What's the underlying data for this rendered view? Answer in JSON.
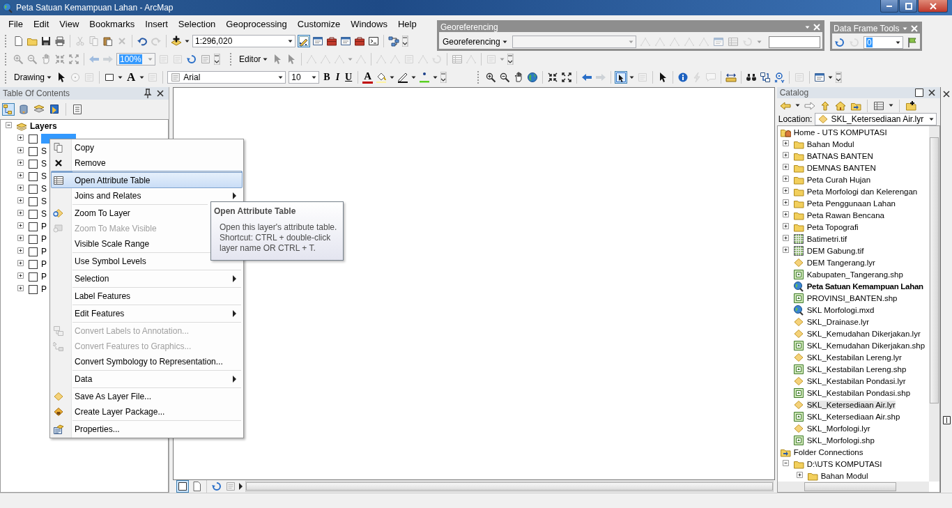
{
  "window": {
    "title": "Peta Satuan Kemampuan Lahan - ArcMap"
  },
  "menu": [
    "File",
    "Edit",
    "View",
    "Bookmarks",
    "Insert",
    "Selection",
    "Geoprocessing",
    "Customize",
    "Windows",
    "Help"
  ],
  "standard_toolbar": {
    "scale": "1:296,020",
    "editor_toolbar_on": true
  },
  "tools_toolbar": {
    "zoom_percent": "100%",
    "editor": "Editor"
  },
  "draw_toolbar": {
    "drawing": "Drawing",
    "text_tool": "A",
    "font": "Arial",
    "font_size": "10",
    "bold": "B",
    "italic": "I",
    "underline": "U",
    "font_color": "A",
    "select_elements_on": true
  },
  "georeferencing": {
    "title": "Georeferencing",
    "menu": "Georeferencing"
  },
  "data_frame_tools": {
    "title": "Data Frame Tools",
    "value": "0"
  },
  "toc": {
    "title": "Table Of Contents",
    "root": "Layers",
    "root_expanded": true,
    "list_by_drawing_order_on": true,
    "layers": [
      {
        "checked": false,
        "expanded": false,
        "selected": true
      },
      {
        "label": "S",
        "checked": false,
        "expanded": false,
        "selected": false
      },
      {
        "label": "S",
        "checked": false,
        "expanded": false,
        "selected": false
      },
      {
        "label": "S",
        "checked": false,
        "expanded": false,
        "selected": false
      },
      {
        "label": "S",
        "checked": false,
        "expanded": false,
        "selected": false
      },
      {
        "label": "S",
        "checked": false,
        "expanded": false,
        "selected": false
      },
      {
        "label": "S",
        "checked": false,
        "expanded": false,
        "selected": false
      },
      {
        "label": "P",
        "checked": false,
        "expanded": false,
        "selected": false
      },
      {
        "label": "P",
        "checked": false,
        "expanded": false,
        "selected": false
      },
      {
        "label": "P",
        "checked": false,
        "expanded": false,
        "selected": false
      },
      {
        "label": "P",
        "checked": false,
        "expanded": false,
        "selected": false
      },
      {
        "label": "P",
        "checked": false,
        "expanded": false,
        "selected": false
      },
      {
        "label": "P",
        "checked": false,
        "expanded": false,
        "selected": false
      }
    ]
  },
  "context_menu": [
    {
      "label": "Copy",
      "disabled": false,
      "submenu": false,
      "selected": false,
      "divider_above": false
    },
    {
      "label": "Remove",
      "disabled": false,
      "submenu": false,
      "selected": false,
      "divider_above": false
    },
    {
      "label": "Open Attribute Table",
      "disabled": false,
      "submenu": false,
      "selected": true,
      "divider_above": true
    },
    {
      "label": "Joins and Relates",
      "disabled": false,
      "submenu": true,
      "selected": false,
      "divider_above": false
    },
    {
      "label": "Zoom To Layer",
      "disabled": false,
      "submenu": false,
      "selected": false,
      "divider_above": true
    },
    {
      "label": "Zoom To Make Visible",
      "disabled": true,
      "submenu": false,
      "selected": false,
      "divider_above": false
    },
    {
      "label": "Visible Scale Range",
      "disabled": false,
      "selected": false,
      "divider_above": false
    },
    {
      "label": "Use Symbol Levels",
      "disabled": false,
      "submenu": false,
      "selected": false,
      "divider_above": true
    },
    {
      "label": "Selection",
      "disabled": false,
      "submenu": true,
      "selected": false,
      "divider_above": true
    },
    {
      "label": "Label Features",
      "disabled": false,
      "submenu": false,
      "selected": false,
      "divider_above": true
    },
    {
      "label": "Edit Features",
      "disabled": false,
      "submenu": true,
      "selected": false,
      "divider_above": true
    },
    {
      "label": "Convert Labels to Annotation...",
      "disabled": true,
      "submenu": false,
      "selected": false,
      "divider_above": true
    },
    {
      "label": "Convert Features to Graphics...",
      "disabled": true,
      "submenu": false,
      "selected": false,
      "divider_above": false
    },
    {
      "label": "Convert Symbology to Representation...",
      "disabled": false,
      "submenu": false,
      "selected": false,
      "divider_above": false
    },
    {
      "label": "Data",
      "disabled": false,
      "submenu": true,
      "selected": false,
      "divider_above": true
    },
    {
      "label": "Save As Layer File...",
      "disabled": false,
      "submenu": false,
      "selected": false,
      "divider_above": true
    },
    {
      "label": "Create Layer Package...",
      "disabled": false,
      "submenu": false,
      "selected": false,
      "divider_above": false
    },
    {
      "label": "Properties...",
      "disabled": false,
      "submenu": false,
      "selected": false,
      "divider_above": true
    }
  ],
  "tooltip": {
    "title": "Open Attribute Table",
    "text": "Open this layer's attribute table. Shortcut: CTRL + double-click layer name OR CTRL + T."
  },
  "catalog": {
    "title": "Catalog",
    "location_label": "Location:",
    "location": "SKL_Ketersediaan Air.lyr",
    "tree": [
      {
        "label": "Home - UTS KOMPUTASI",
        "kind": "home",
        "selected": false,
        "open": false,
        "children": [
          {
            "label": "Bahan Modul",
            "kind": "folder",
            "expanded": false,
            "selected": false,
            "open": false
          },
          {
            "label": "BATNAS BANTEN",
            "kind": "folder",
            "expanded": false,
            "selected": false,
            "open": false
          },
          {
            "label": "DEMNAS BANTEN",
            "kind": "folder",
            "expanded": false,
            "selected": false,
            "open": false
          },
          {
            "label": "Peta Curah Hujan",
            "kind": "folder",
            "expanded": false,
            "selected": false,
            "open": false
          },
          {
            "label": "Peta Morfologi dan Kelerengan",
            "kind": "folder",
            "expanded": false,
            "selected": false,
            "open": false
          },
          {
            "label": "Peta Penggunaan Lahan",
            "kind": "folder",
            "expanded": false,
            "selected": false,
            "open": false
          },
          {
            "label": "Peta Rawan Bencana",
            "kind": "folder",
            "expanded": false,
            "selected": false,
            "open": false
          },
          {
            "label": "Peta Topografi",
            "kind": "folder",
            "expanded": false,
            "selected": false,
            "open": false
          },
          {
            "label": "Batimetri.tif",
            "kind": "raster",
            "expanded": false,
            "selected": false,
            "open": false
          },
          {
            "label": "DEM Gabung.tif",
            "kind": "raster",
            "expanded": false,
            "selected": false,
            "open": false
          },
          {
            "label": "DEM Tangerang.lyr",
            "kind": "layer",
            "selected": false,
            "open": false
          },
          {
            "label": "Kabupaten_Tangerang.shp",
            "kind": "shape",
            "selected": false,
            "open": false
          },
          {
            "label": "Peta Satuan Kemampuan Lahan",
            "kind": "map",
            "selected": false,
            "open": true
          },
          {
            "label": "PROVINSI_BANTEN.shp",
            "kind": "shape",
            "selected": false,
            "open": false
          },
          {
            "label": "SKL Morfologi.mxd",
            "kind": "map",
            "selected": false,
            "open": false
          },
          {
            "label": "SKL_Drainase.lyr",
            "kind": "layer",
            "selected": false,
            "open": false
          },
          {
            "label": "SKL_Kemudahan Dikerjakan.lyr",
            "kind": "layer",
            "selected": false,
            "open": false
          },
          {
            "label": "SKL_Kemudahan Dikerjakan.shp",
            "kind": "shape",
            "selected": false,
            "open": false
          },
          {
            "label": "SKL_Kestabilan Lereng.lyr",
            "kind": "layer",
            "selected": false,
            "open": false
          },
          {
            "label": "SKL_Kestabilan Lereng.shp",
            "kind": "shape",
            "selected": false,
            "open": false
          },
          {
            "label": "SKL_Kestabilan Pondasi.lyr",
            "kind": "layer",
            "selected": false,
            "open": false
          },
          {
            "label": "SKL_Kestabilan Pondasi.shp",
            "kind": "shape",
            "selected": false,
            "open": false
          },
          {
            "label": "SKL_Ketersediaan Air.lyr",
            "kind": "layer",
            "selected": true,
            "open": false
          },
          {
            "label": "SKL_Ketersediaan Air.shp",
            "kind": "shape",
            "selected": false,
            "open": false
          },
          {
            "label": "SKL_Morfologi.lyr",
            "kind": "layer",
            "selected": false,
            "open": false
          },
          {
            "label": "SKL_Morfologi.shp",
            "kind": "shape",
            "selected": false,
            "open": false
          }
        ]
      },
      {
        "label": "Folder Connections",
        "kind": "connections",
        "selected": false,
        "open": false,
        "children": [
          {
            "label": "D:\\UTS KOMPUTASI",
            "kind": "folder",
            "expanded": true,
            "selected": false,
            "open": false,
            "children": [
              {
                "label": "Bahan Modul",
                "kind": "folder",
                "expanded": false,
                "selected": false,
                "open": false
              }
            ]
          }
        ]
      }
    ]
  }
}
